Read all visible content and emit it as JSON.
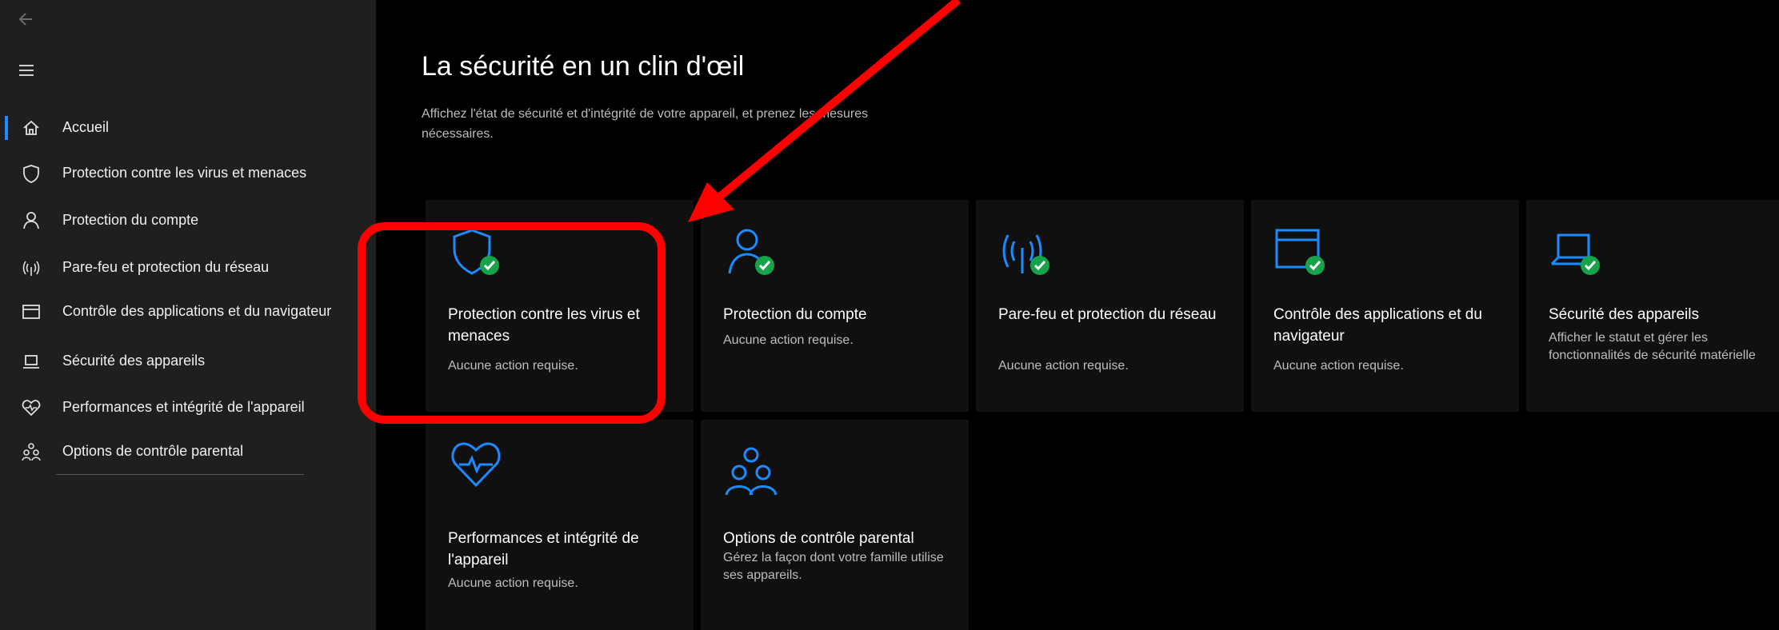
{
  "sidebar": {
    "items": [
      {
        "label": "Accueil",
        "icon": "home-icon",
        "active": true
      },
      {
        "label": "Protection contre les virus et menaces",
        "icon": "shield-icon"
      },
      {
        "label": "Protection du compte",
        "icon": "person-icon"
      },
      {
        "label": "Pare-feu et protection du réseau",
        "icon": "wifi-antenna-icon"
      },
      {
        "label": "Contrôle des applications et du navigateur",
        "icon": "app-window-icon"
      },
      {
        "label": "Sécurité des appareils",
        "icon": "laptop-icon"
      },
      {
        "label": "Performances et intégrité de l'appareil",
        "icon": "heart-pulse-icon"
      },
      {
        "label": "Options de contrôle parental",
        "icon": "family-icon"
      }
    ]
  },
  "main": {
    "title": "La sécurité en un clin d'œil",
    "description": "Affichez l'état de sécurité et d'intégrité de votre appareil, et prenez les mesures nécessaires.",
    "tiles": [
      {
        "title": "Protection contre les virus et menaces",
        "status": "Aucune action requise.",
        "icon": "shield-check-icon"
      },
      {
        "title": "Protection du compte",
        "status": "Aucune action requise.",
        "icon": "person-check-icon"
      },
      {
        "title": "Pare-feu et protection du réseau",
        "status": "Aucune action requise.",
        "icon": "antenna-check-icon"
      },
      {
        "title": "Contrôle des applications et du navigateur",
        "status": "Aucune action requise.",
        "icon": "window-check-icon"
      },
      {
        "title": "Sécurité des appareils",
        "status": "Afficher le statut et gérer les fonctionnalités de sécurité matérielle",
        "icon": "laptop-check-icon"
      },
      {
        "title": "Performances et intégrité de l'appareil",
        "status": "Aucune action requise.",
        "icon": "heart-pulse-icon"
      },
      {
        "title": "Options de contrôle parental",
        "status": "Gérez la façon dont votre famille utilise ses appareils.",
        "icon": "family-icon"
      }
    ]
  },
  "colors": {
    "accent": "#1a8cff",
    "check": "#16a34a",
    "annotation": "#ff0000",
    "sidebar_bg": "#1f1f1f",
    "tile_bg": "#101010"
  }
}
